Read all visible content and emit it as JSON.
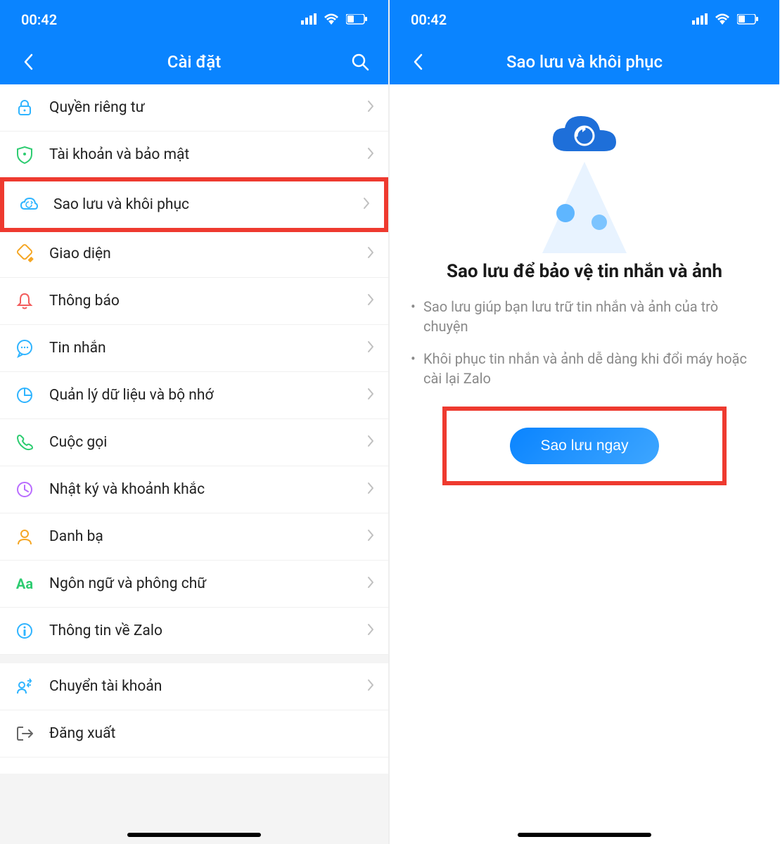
{
  "status": {
    "time": "00:42"
  },
  "left": {
    "title": "Cài đặt",
    "items": [
      {
        "icon": "lock",
        "color": "#2fb4ff",
        "label": "Quyền riêng tư",
        "highlight": false
      },
      {
        "icon": "shield",
        "color": "#2ecc71",
        "label": "Tài khoản và bảo mật",
        "highlight": false
      },
      {
        "icon": "cloud",
        "color": "#2fb4ff",
        "label": "Sao lưu và khôi phục",
        "highlight": true
      },
      {
        "icon": "brush",
        "color": "#f5a623",
        "label": "Giao diện",
        "highlight": false
      },
      {
        "icon": "bell",
        "color": "#f25c5c",
        "label": "Thông báo",
        "highlight": false
      },
      {
        "icon": "chat",
        "color": "#2fb4ff",
        "label": "Tin nhắn",
        "highlight": false
      },
      {
        "icon": "pie",
        "color": "#2fb4ff",
        "label": "Quản lý dữ liệu và bộ nhớ",
        "highlight": false
      },
      {
        "icon": "call",
        "color": "#2ecc71",
        "label": "Cuộc gọi",
        "highlight": false
      },
      {
        "icon": "clock",
        "color": "#b96cff",
        "label": "Nhật ký và khoảnh khắc",
        "highlight": false
      },
      {
        "icon": "contact",
        "color": "#f5a623",
        "label": "Danh bạ",
        "highlight": false
      },
      {
        "icon": "aa",
        "color": "#2ecc71",
        "label": "Ngôn ngữ và phông chữ",
        "highlight": false
      },
      {
        "icon": "info",
        "color": "#2fb4ff",
        "label": "Thông tin về Zalo",
        "highlight": false,
        "gapAfter": true
      },
      {
        "icon": "switch",
        "color": "#2fb4ff",
        "label": "Chuyển tài khoản",
        "highlight": false
      },
      {
        "icon": "logout",
        "color": "#666666",
        "label": "Đăng xuất",
        "highlight": false,
        "noChevron": true
      }
    ]
  },
  "right": {
    "title": "Sao lưu và khôi phục",
    "heading": "Sao lưu để bảo vệ tin nhắn và ảnh",
    "bullets": [
      "Sao lưu giúp bạn lưu trữ tin nhắn và ảnh của trò chuyện",
      "Khôi phục tin nhắn và ảnh dễ dàng khi đổi máy hoặc cài lại Zalo"
    ],
    "cta": "Sao lưu ngay"
  }
}
